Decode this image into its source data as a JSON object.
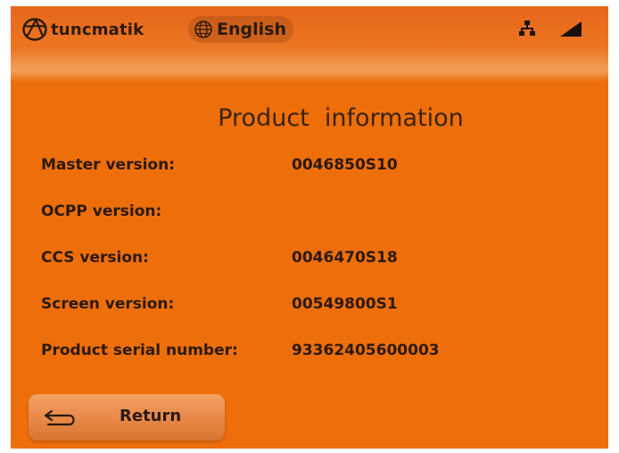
{
  "header": {
    "brand": "tuncmatik",
    "language_label": "English",
    "icons": [
      "tuncmatik-logo-icon",
      "globe-icon",
      "network-icon",
      "signal-icon"
    ]
  },
  "page": {
    "title": "Product  information"
  },
  "info_rows": [
    {
      "label": "Master version:",
      "value": "0046850S10"
    },
    {
      "label": "OCPP version:",
      "value": ""
    },
    {
      "label": "CCS version:",
      "value": "0046470S18"
    },
    {
      "label": "Screen version:",
      "value": "00549800S1"
    },
    {
      "label": "Product serial number:",
      "value": "93362405600003"
    }
  ],
  "footer": {
    "return_label": "Return"
  },
  "colors": {
    "background": "#ee6e0a",
    "text": "#2a1a10",
    "title": "#3a2412"
  }
}
